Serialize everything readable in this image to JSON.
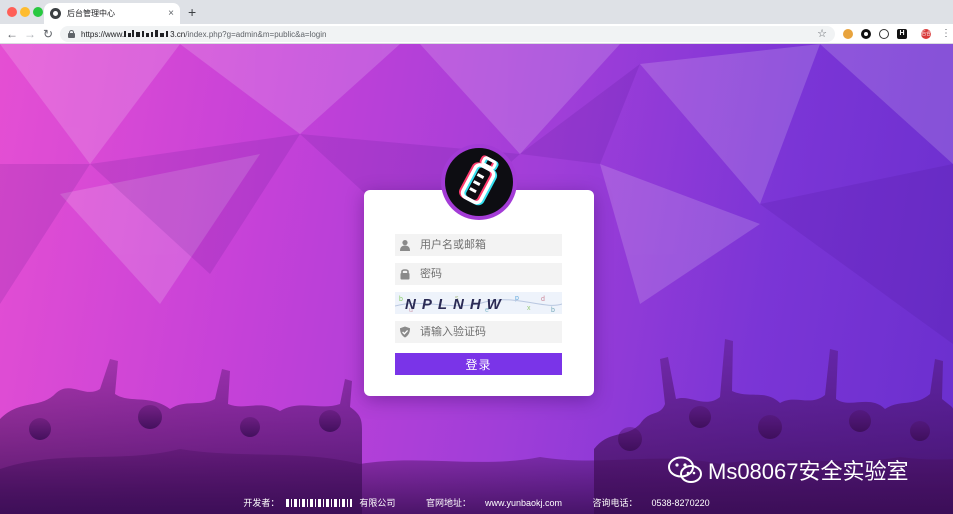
{
  "browser": {
    "tab_title": "后台管理中心",
    "tab_close": "×",
    "new_tab": "+",
    "url_prefix": "https://www.",
    "url_host_suffix": "3.cn",
    "url_path": "/index.php?g=admin&m=public&a=login",
    "profile_initials": "后合",
    "extension_h": "H",
    "icons": [
      "back-arrow-icon",
      "forward-arrow-icon",
      "reload-icon",
      "lock-icon",
      "bookmark-star-icon",
      "cookie-extension-icon",
      "circle-extension-icon",
      "eye-extension-icon",
      "h-extension-icon",
      "profile-avatar",
      "kebab-menu-icon"
    ]
  },
  "login": {
    "username_placeholder": "用户名或邮箱",
    "password_placeholder": "密码",
    "captcha_text": "NPLNHW",
    "code_placeholder": "请输入验证码",
    "submit_label": "登录",
    "accent": "#7a34e8"
  },
  "footer": {
    "developer_label": "开发者：",
    "developer_suffix": "有限公司",
    "website_label": "官网地址：",
    "website": "www.yunbaokj.com",
    "phone_label": "咨询电话：",
    "phone": "0538-8270220"
  },
  "watermark": {
    "text": "Ms08067安全实验室"
  }
}
